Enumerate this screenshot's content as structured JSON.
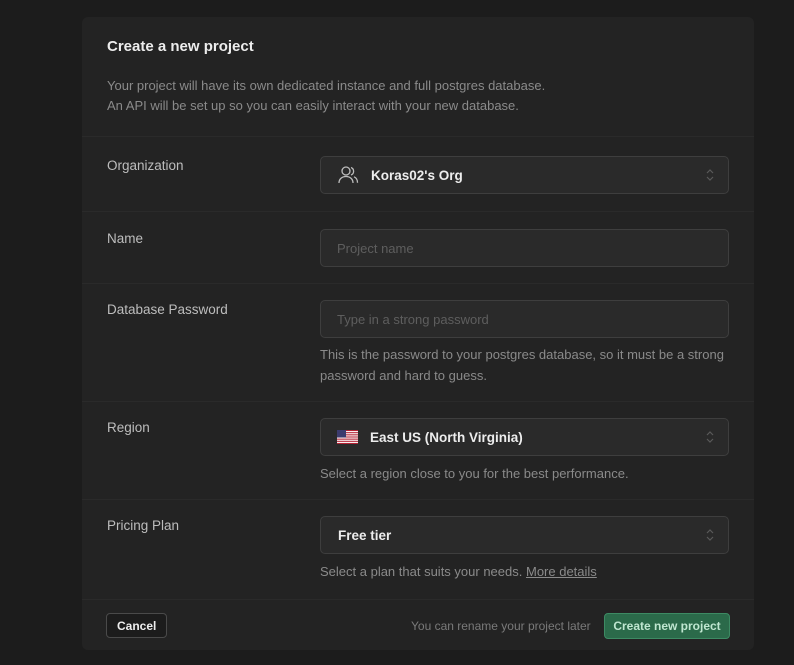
{
  "dialog": {
    "title": "Create a new project",
    "description_line1": "Your project will have its own dedicated instance and full postgres database.",
    "description_line2": "An API will be set up so you can easily interact with your new database."
  },
  "organization": {
    "label": "Organization",
    "value": "Koras02's Org",
    "icon": "users-icon"
  },
  "name": {
    "label": "Name",
    "placeholder": "Project name",
    "value": ""
  },
  "password": {
    "label": "Database Password",
    "placeholder": "Type in a strong password",
    "value": "",
    "help": "This is the password to your postgres database, so it must be a strong password and hard to guess."
  },
  "region": {
    "label": "Region",
    "value": "East US (North Virginia)",
    "icon": "us-flag-icon",
    "help": "Select a region close to you for the best performance."
  },
  "pricing": {
    "label": "Pricing Plan",
    "value": "Free tier",
    "help": "Select a plan that suits your needs.",
    "link": "More details"
  },
  "footer": {
    "cancel_label": "Cancel",
    "note": "You can rename your project later",
    "create_label": "Create new project"
  },
  "colors": {
    "background": "#1c1c1c",
    "panel": "#232323",
    "accent": "#2b6a4a"
  }
}
